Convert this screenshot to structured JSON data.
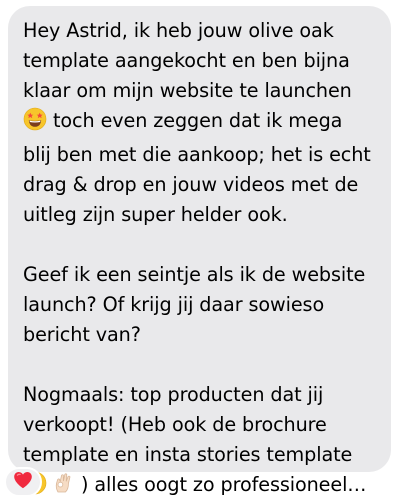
{
  "message": {
    "paragraph1": {
      "line1": "Hey Astrid, ik heb jouw olive oak",
      "line2": "template aangekocht en ben bijna",
      "line3": "klaar om mijn website te launchen",
      "line4_text": "toch even zeggen dat ik mega",
      "line4_emoji": "star-struck-emoji",
      "line5": "blij ben met die aankoop; het is echt",
      "line6": "drag & drop en jouw videos met de",
      "line7": "uitleg zijn super helder ook."
    },
    "paragraph2": {
      "line1": "Geef ik een seintje als ik de website",
      "line2": "launch? Of krijg jij daar sowieso",
      "line3": "bericht van?"
    },
    "paragraph3": {
      "line1": "Nogmaals: top producten dat jij",
      "line2": "verkoopt! (Heb ook de brochure",
      "line3": "template en insta stories template",
      "line4_text": ") alles oogt zo professioneel…",
      "line4_emojis": [
        "grinning-face-emoji",
        "ok-hand-emoji"
      ]
    }
  },
  "reaction": {
    "icon": "red-heart-icon",
    "color": "#f02a3f"
  },
  "colors": {
    "bubble": "#e9e9eb",
    "text": "#000000",
    "background": "#ffffff"
  }
}
